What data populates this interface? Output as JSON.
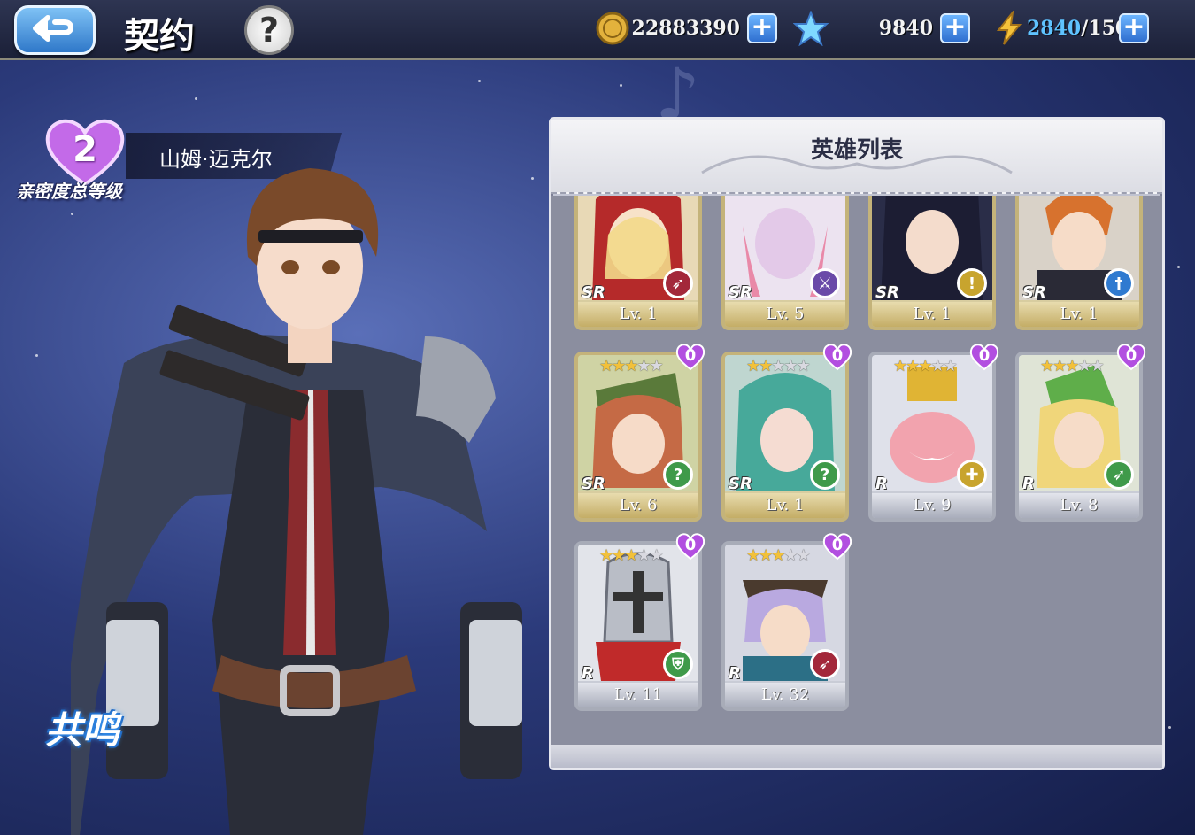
{
  "header": {
    "back_label": "",
    "title": "契约",
    "help_label": "?",
    "gold": "22883390",
    "crystal": "9840",
    "energy_current": "2840",
    "energy_max": "/150",
    "plus_label": "+"
  },
  "hero": {
    "intimacy_level": "2",
    "intimacy_label": "亲密度总等级",
    "name": "山姆·迈克尔"
  },
  "resonance_label": "共鸣",
  "panel": {
    "title": "英雄列表",
    "cards": [
      {
        "rarity": "SR",
        "level": "Lv. 1",
        "stars": "",
        "affinity": "",
        "class": "bow"
      },
      {
        "rarity": "SR",
        "level": "Lv. 5",
        "stars": "",
        "affinity": "",
        "class": "sword"
      },
      {
        "rarity": "SR",
        "level": "Lv. 1",
        "stars": "",
        "affinity": "",
        "class": "dagger"
      },
      {
        "rarity": "SR",
        "level": "Lv. 1",
        "stars": "",
        "affinity": "",
        "class": "sword"
      },
      {
        "rarity": "SR",
        "level": "Lv. 6",
        "stars": 3,
        "affinity": "0",
        "class": "mystic"
      },
      {
        "rarity": "SR",
        "level": "Lv. 1",
        "stars": 2,
        "affinity": "0",
        "class": "mystic"
      },
      {
        "rarity": "R",
        "level": "Lv. 9",
        "stars": 3,
        "affinity": "0",
        "class": "cross"
      },
      {
        "rarity": "R",
        "level": "Lv. 8",
        "stars": 3,
        "affinity": "0",
        "class": "bow"
      },
      {
        "rarity": "R",
        "level": "Lv. 11",
        "stars": 3,
        "affinity": "0",
        "class": "shield"
      },
      {
        "rarity": "R",
        "level": "Lv. 32",
        "stars": 3,
        "affinity": "0",
        "class": "bow"
      }
    ]
  },
  "colors": {
    "gold_frame": "#c4b37a",
    "silver_frame": "#a8acb8",
    "accent_blue": "#5fc3ff",
    "affinity_purple": "#b24fe0"
  }
}
